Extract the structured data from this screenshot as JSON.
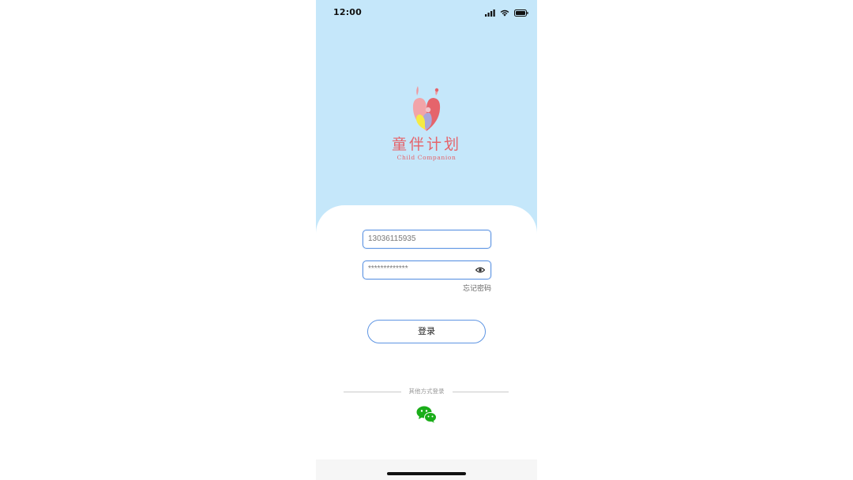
{
  "status_bar": {
    "time": "12:00",
    "icons": [
      "cellular-signal-icon",
      "wifi-icon",
      "battery-icon"
    ]
  },
  "logo": {
    "name_cn": "童伴计划",
    "name_en": "Child Companion"
  },
  "form": {
    "phone_value": "13036115935",
    "password_value": "*************",
    "forgot_password": "忘记密码",
    "login_button": "登录"
  },
  "alt_login": {
    "label": "其他方式登录",
    "icon": "wechat-icon"
  },
  "colors": {
    "header_bg": "#c5e7fa",
    "accent": "#5e95e3",
    "brand": "#e5646b",
    "wechat": "#1aad19"
  }
}
